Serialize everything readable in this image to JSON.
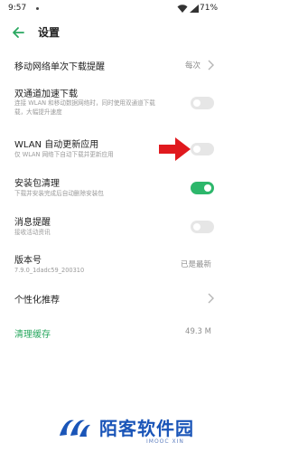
{
  "status_bar": {
    "time": "9:57",
    "battery": "71%",
    "icons": [
      "signal-icon",
      "wifi-icon",
      "battery-icon"
    ]
  },
  "header": {
    "title": "设置",
    "back_icon": "back-arrow-icon"
  },
  "settings": {
    "download_reminder": {
      "title": "移动网络单次下载提醒",
      "value": "每次"
    },
    "dual_channel": {
      "title": "双通道加速下载",
      "subtitle": [
        "连接 WLAN 和移动数据网络时，同时使用双通道下载",
        "载，大幅提升速度"
      ],
      "enabled": false
    },
    "wlan_auto_update": {
      "title": "WLAN 自动更新应用",
      "subtitle": "仅 WLAN 网络下自动下载并更新应用",
      "enabled": false
    },
    "package_cleanup": {
      "title": "安装包清理",
      "subtitle": "下载并安装完成后自动删除安装包",
      "enabled": true
    },
    "message_reminder": {
      "title": "消息提醒",
      "subtitle": "接收活动资讯",
      "enabled": false
    },
    "version": {
      "title": "版本号",
      "number": "7.9.0_1dadc59_200310",
      "status": "已是最新"
    },
    "personalized": {
      "title": "个性化推荐"
    },
    "clear_cache": {
      "title": "清理缓存",
      "size": "49.3 M"
    }
  },
  "colors": {
    "accent_green": "#2db76b",
    "annotation_red": "#e0191e",
    "watermark_blue": "#1a55b8"
  },
  "watermark": {
    "text": "陌客软件园",
    "subtext": "IMOOC XIN"
  }
}
